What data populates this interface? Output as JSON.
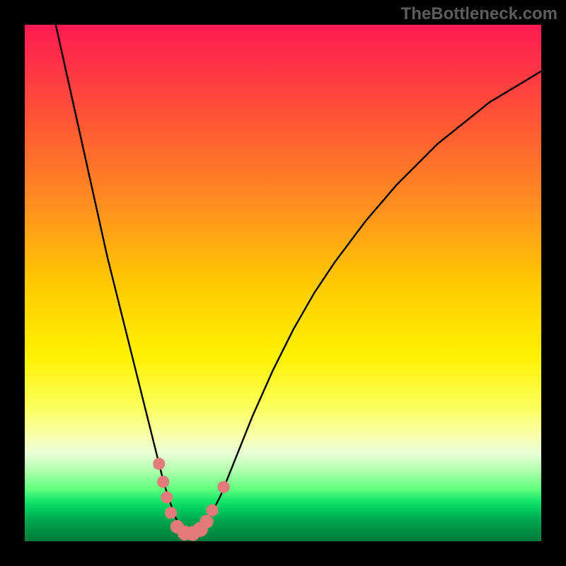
{
  "watermark": "TheBottleneck.com",
  "colors": {
    "marker_fill": "#e47a7a",
    "marker_stroke": "#e47a7a",
    "curve_stroke": "#000000"
  },
  "chart_data": {
    "type": "line",
    "title": "",
    "xlabel": "",
    "ylabel": "",
    "xlim": [
      0,
      100
    ],
    "ylim": [
      0,
      100
    ],
    "curve": {
      "comment": "bottleneck percentage curve; x is relative hardware index, y is bottleneck %",
      "x": [
        6,
        8,
        10,
        12,
        14,
        16,
        18,
        20,
        22,
        24,
        26,
        27,
        28,
        29,
        30,
        31,
        32,
        33,
        34,
        35,
        36,
        38,
        40,
        44,
        48,
        52,
        56,
        60,
        66,
        72,
        80,
        90,
        100
      ],
      "y": [
        100,
        91,
        82,
        73,
        64,
        55,
        47,
        39,
        31,
        23,
        15,
        11,
        8,
        5,
        3,
        2,
        1.5,
        1.5,
        2,
        3,
        5,
        9,
        14,
        24,
        33,
        41,
        48,
        54,
        62,
        69,
        77,
        85,
        91
      ]
    },
    "markers": {
      "comment": "highlighted points near trough",
      "points": [
        {
          "x": 26.0,
          "y": 15.0,
          "r": 8
        },
        {
          "x": 26.8,
          "y": 11.5,
          "r": 8
        },
        {
          "x": 27.5,
          "y": 8.5,
          "r": 8
        },
        {
          "x": 28.3,
          "y": 5.5,
          "r": 8
        },
        {
          "x": 29.5,
          "y": 2.8,
          "r": 9
        },
        {
          "x": 31.0,
          "y": 1.6,
          "r": 10
        },
        {
          "x": 32.5,
          "y": 1.5,
          "r": 10
        },
        {
          "x": 34.0,
          "y": 2.3,
          "r": 10
        },
        {
          "x": 35.2,
          "y": 3.8,
          "r": 9
        },
        {
          "x": 36.3,
          "y": 6.0,
          "r": 8
        },
        {
          "x": 38.5,
          "y": 10.5,
          "r": 8
        }
      ]
    }
  }
}
